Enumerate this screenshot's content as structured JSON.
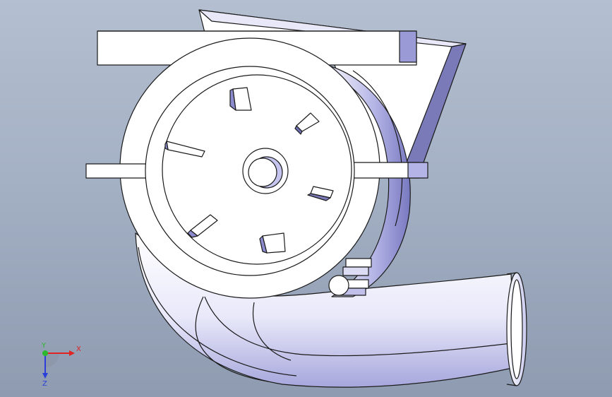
{
  "triad": {
    "x_label": "X",
    "y_label": "Y",
    "z_label": "Z",
    "x_color": "#e02424",
    "y_color": "#2db82d",
    "z_color": "#2a3fd8"
  },
  "model_colors": {
    "face": "#ffffff",
    "edge": "#1a1a1a",
    "shade_light": "#c8c8f0",
    "shade_mid": "#9a9ad8",
    "shade_dark": "#6c6cb0"
  }
}
